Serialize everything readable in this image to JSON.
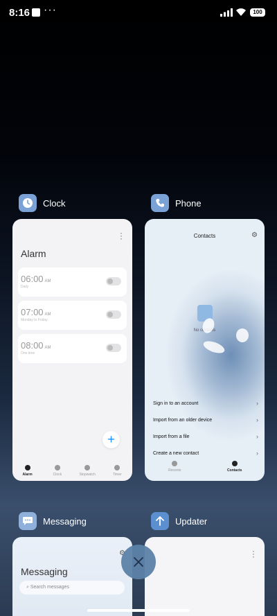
{
  "status_bar": {
    "time": "8:16",
    "more": "···",
    "battery": "100"
  },
  "apps": [
    {
      "name": "Clock",
      "icon": "clock-icon"
    },
    {
      "name": "Phone",
      "icon": "phone-icon"
    },
    {
      "name": "Messaging",
      "icon": "chat-bubble-icon"
    },
    {
      "name": "Updater",
      "icon": "up-arrow-icon"
    }
  ],
  "clock_card": {
    "title": "Alarm",
    "alarms": [
      {
        "time": "06:00",
        "ampm": "AM",
        "sub": "Daily"
      },
      {
        "time": "07:00",
        "ampm": "AM",
        "sub": "Monday to Friday"
      },
      {
        "time": "08:00",
        "ampm": "AM",
        "sub": "One time"
      }
    ],
    "nav": [
      "Alarm",
      "Clock",
      "Stopwatch",
      "Timer"
    ]
  },
  "phone_card": {
    "title": "Contacts",
    "empty": "No contacts",
    "actions": [
      "Sign in to an account",
      "Import from an older device",
      "Import from a file",
      "Create a new contact"
    ],
    "nav": [
      "Recents",
      "Contacts"
    ]
  },
  "msg_card": {
    "title": "Messaging",
    "search_placeholder": "Search messages"
  },
  "colors": {
    "clock_icon": "#7aa2d6",
    "phone_icon": "#7aa2d6",
    "msg_icon": "#8eb0db",
    "upd_icon": "#5b8fd0",
    "close": "#5d82a8"
  }
}
